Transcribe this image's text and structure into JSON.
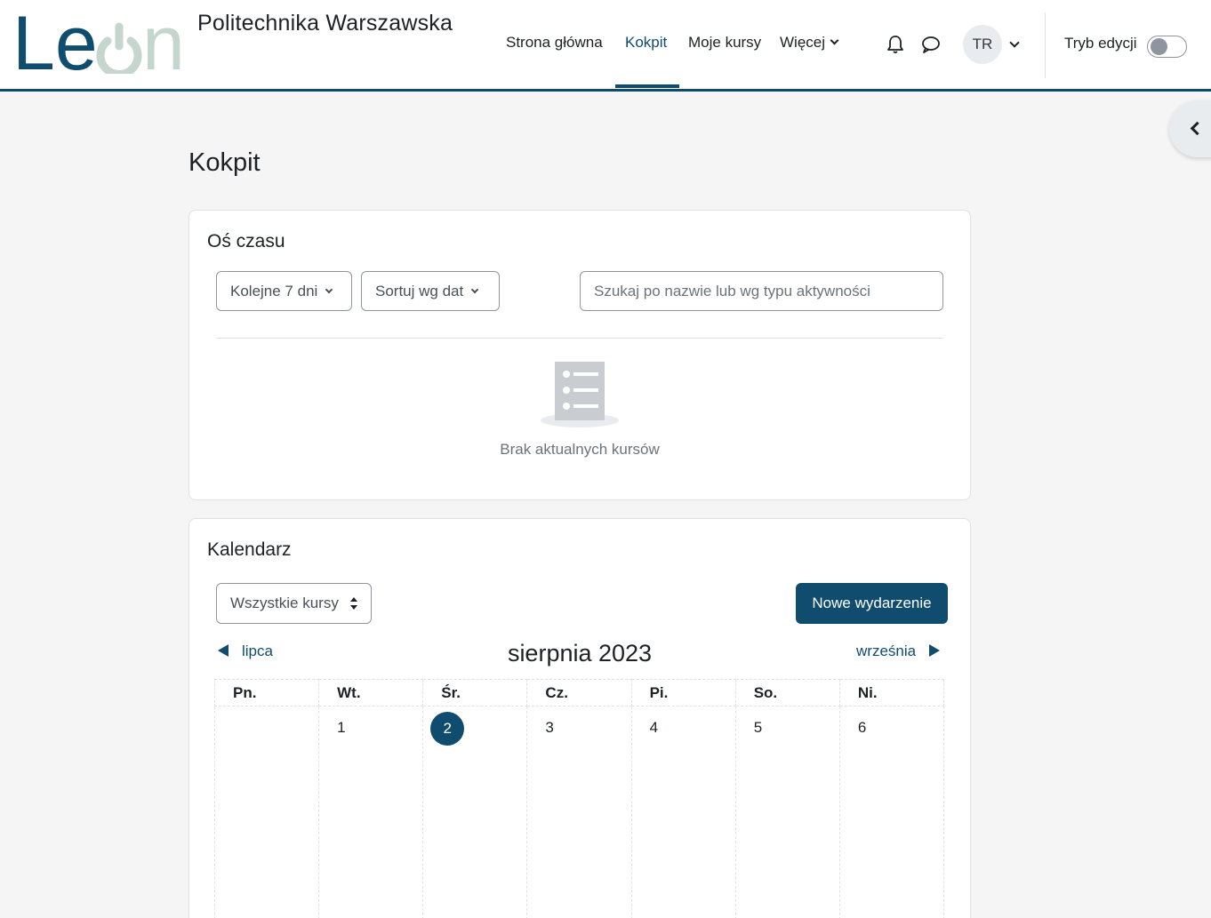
{
  "brand": {
    "logo_text": "Leon",
    "site_name": "Politechnika Warszawska",
    "colors": {
      "primary": "#0f4c6e",
      "logo_light": "#c5d6cf"
    }
  },
  "nav": {
    "items": [
      {
        "label": "Strona główna",
        "active": false
      },
      {
        "label": "Kokpit",
        "active": true
      },
      {
        "label": "Moje kursy",
        "active": false
      },
      {
        "label": "Więcej",
        "active": false,
        "dropdown": true
      }
    ],
    "icons": [
      "bell-icon",
      "chat-icon"
    ],
    "user_initials": "TR",
    "edit_mode_label": "Tryb edycji",
    "edit_mode_on": false
  },
  "page": {
    "title": "Kokpit"
  },
  "timeline": {
    "title": "Oś czasu",
    "filter_label": "Kolejne 7 dni",
    "sort_label": "Sortuj wg dat",
    "search_placeholder": "Szukaj po nazwie lub wg typu aktywności",
    "empty_message": "Brak aktualnych kursów"
  },
  "calendar": {
    "title": "Kalendarz",
    "course_select": "Wszystkie kursy",
    "new_event_label": "Nowe wydarzenie",
    "prev_month": "lipca",
    "next_month": "września",
    "month_title": "sierpnia 2023",
    "weekdays": [
      "Pn.",
      "Wt.",
      "Śr.",
      "Cz.",
      "Pi.",
      "So.",
      "Ni."
    ],
    "week1": [
      "",
      "1",
      "2",
      "3",
      "4",
      "5",
      "6"
    ],
    "today": "2"
  }
}
